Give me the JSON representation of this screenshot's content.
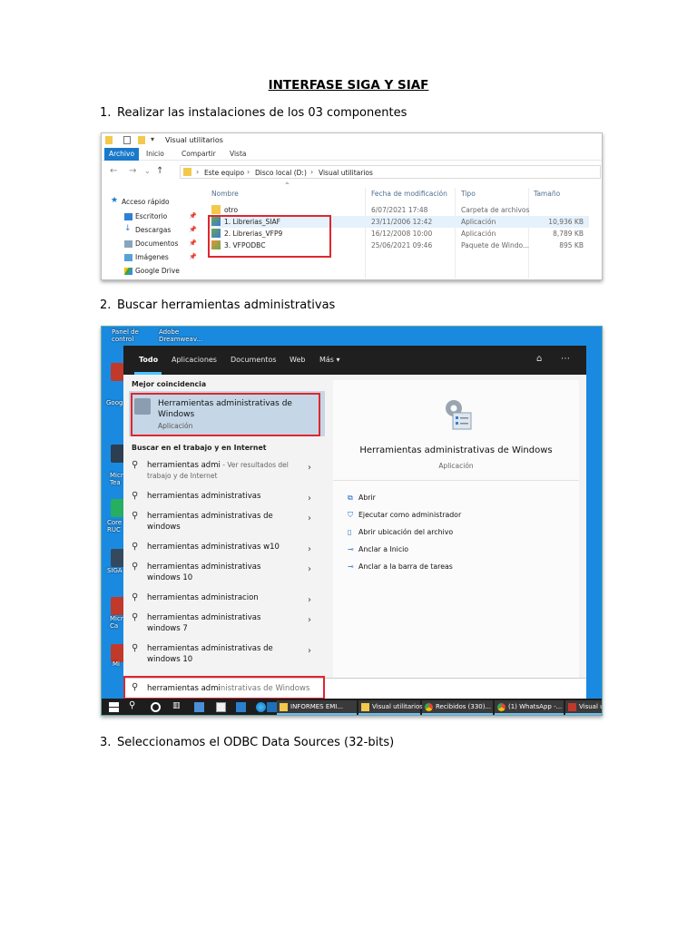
{
  "doc": {
    "title": "INTERFASE SIGA Y SIAF",
    "steps": [
      {
        "num": "1.",
        "text": "Realizar las instalaciones de los 03 componentes"
      },
      {
        "num": "2.",
        "text": "Buscar herramientas administrativas"
      },
      {
        "num": "3.",
        "text": "Seleccionamos el ODBC Data Sources (32-bits)"
      }
    ]
  },
  "explorer": {
    "window_title": "Visual utilitarios",
    "ribbon_tabs": [
      "Archivo",
      "Inicio",
      "Compartir",
      "Vista"
    ],
    "breadcrumbs": [
      "Este equipo",
      "Disco local (D:)",
      "Visual utilitarios"
    ],
    "sidebar": [
      {
        "label": "Acceso rápido",
        "icon": "star-icon"
      },
      {
        "label": "Escritorio",
        "icon": "desktop-icon"
      },
      {
        "label": "Descargas",
        "icon": "download-icon"
      },
      {
        "label": "Documentos",
        "icon": "documents-icon"
      },
      {
        "label": "Imágenes",
        "icon": "pictures-icon"
      },
      {
        "label": "Google Drive",
        "icon": "google-drive-icon"
      }
    ],
    "columns": [
      "Nombre",
      "Fecha de modificación",
      "Tipo",
      "Tamaño"
    ],
    "rows": [
      {
        "name": "otro",
        "date": "6/07/2021 17:48",
        "type": "Carpeta de archivos",
        "size": "",
        "icon": "folder-icon"
      },
      {
        "name": "1. Librerias_SIAF",
        "date": "23/11/2006 12:42",
        "type": "Aplicación",
        "size": "10,936 KB",
        "icon": "installer-icon"
      },
      {
        "name": "2. Librerias_VFP9",
        "date": "16/12/2008 10:00",
        "type": "Aplicación",
        "size": "8,789 KB",
        "icon": "installer-icon"
      },
      {
        "name": "3. VFPODBC",
        "date": "25/06/2021 09:46",
        "type": "Paquete de Windo...",
        "size": "895 KB",
        "icon": "msi-package-icon"
      }
    ]
  },
  "desktop": {
    "labels": [
      "Panel de control",
      "Adobe Dreamweav...",
      "Goog",
      "Micr Tea",
      "Core RUC",
      "SIGA",
      "Micr Ca",
      "Mi"
    ]
  },
  "search": {
    "tabs": [
      "Todo",
      "Aplicaciones",
      "Documentos",
      "Web",
      "Más ▾"
    ],
    "best_match_heading": "Mejor coincidencia",
    "best_match": {
      "title": "Herramientas administrativas de Windows",
      "subtitle": "Aplicación"
    },
    "web_heading": "Buscar en el trabajo y en Internet",
    "suggestions": [
      {
        "text": "herramientas admi",
        "hint": " - Ver resultados del trabajo y de Internet"
      },
      {
        "text": "herramientas administrativas",
        "hint": ""
      },
      {
        "text": "herramientas administrativas de windows",
        "hint": ""
      },
      {
        "text": "herramientas administrativas w10",
        "hint": ""
      },
      {
        "text": "herramientas administrativas windows 10",
        "hint": ""
      },
      {
        "text": "herramientas administracion",
        "hint": ""
      },
      {
        "text": "herramientas administrativas windows 7",
        "hint": ""
      },
      {
        "text": "herramientas administrativas de windows 10",
        "hint": ""
      }
    ],
    "preview": {
      "title": "Herramientas administrativas de Windows",
      "subtitle": "Aplicación",
      "actions": [
        "Abrir",
        "Ejecutar como administrador",
        "Abrir ubicación del archivo",
        "Anclar a Inicio",
        "Anclar a la barra de tareas"
      ]
    },
    "query_typed": "herramientas admi",
    "query_completion": "nistrativas de Windows"
  },
  "taskbar": {
    "buttons": [
      "INFORMES EMI...",
      "Visual utilitarios",
      "Recibidos (330)...",
      "(1) WhatsApp -...",
      "Visual u"
    ]
  },
  "colors": {
    "accent": "#1979ca",
    "highlight": "#e0262f",
    "desktop": "#1a8ae0",
    "search_dark": "#1f1f1f"
  }
}
